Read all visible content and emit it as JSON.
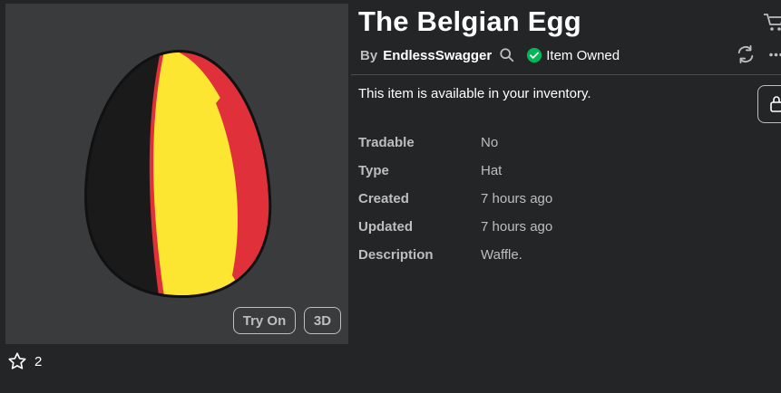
{
  "item": {
    "title": "The Belgian Egg",
    "by_prefix": "By",
    "creator": "EndlessSwagger",
    "owned_label": "Item Owned",
    "availability": "This item is available in your inventory."
  },
  "thumbnail": {
    "try_on_label": "Try On",
    "view_3d_label": "3D",
    "egg_colors": [
      "#111111",
      "#fde631",
      "#e0303a"
    ]
  },
  "favorites": {
    "count": "2"
  },
  "details": [
    {
      "label": "Tradable",
      "value": "No"
    },
    {
      "label": "Type",
      "value": "Hat"
    },
    {
      "label": "Created",
      "value": "7 hours ago"
    },
    {
      "label": "Updated",
      "value": "7 hours ago"
    },
    {
      "label": "Description",
      "value": "Waffle."
    }
  ],
  "icons": {
    "search": "search-icon",
    "owned": "check-circle-icon",
    "favorite": "star-icon",
    "cart": "cart-icon",
    "refresh": "refresh-icon",
    "more": "more-icon"
  },
  "colors": {
    "background": "#232527",
    "panel": "#393b3d",
    "owned_green": "#02b757",
    "muted_text": "#bdbebe"
  }
}
